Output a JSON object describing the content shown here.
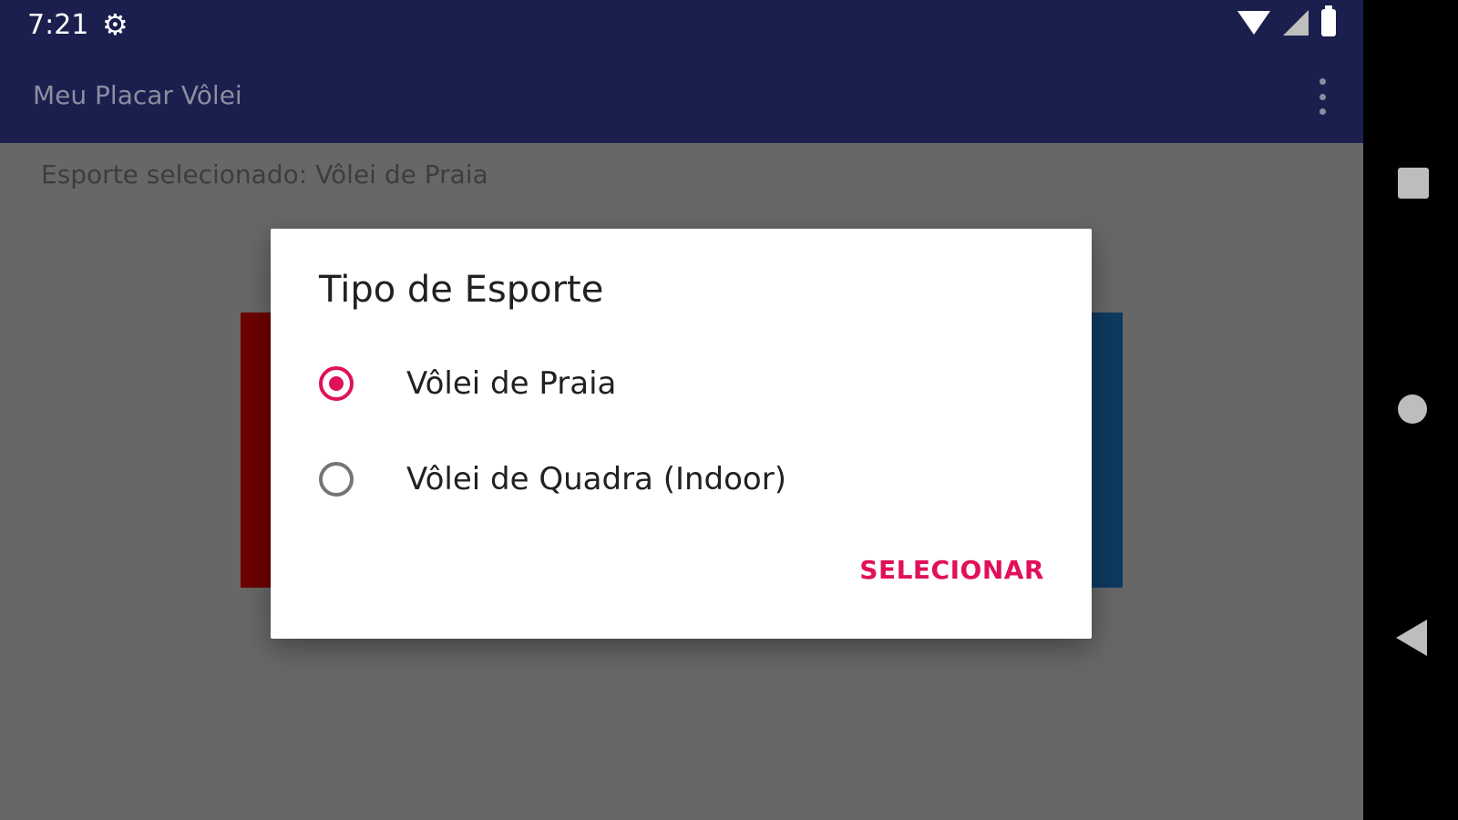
{
  "status_bar": {
    "time": "7:21",
    "icons": [
      "settings-icon",
      "wifi-icon",
      "signal-icon",
      "battery-icon"
    ]
  },
  "app_bar": {
    "title": "Meu Placar Vôlei",
    "menu_icon": "more-vert-icon"
  },
  "main": {
    "subtitle": "Esporte selecionado: Vôlei de Praia",
    "team_colors": {
      "left": "#6b0000",
      "right": "#0e3a60"
    }
  },
  "dialog": {
    "title": "Tipo de Esporte",
    "options": [
      {
        "label": "Vôlei de Praia",
        "selected": true
      },
      {
        "label": "Vôlei de Quadra (Indoor)",
        "selected": false
      }
    ],
    "confirm_label": "SELECIONAR",
    "accent_color": "#e0105a"
  },
  "nav_bar": {
    "buttons": [
      "recents-icon",
      "home-icon",
      "back-icon"
    ]
  }
}
